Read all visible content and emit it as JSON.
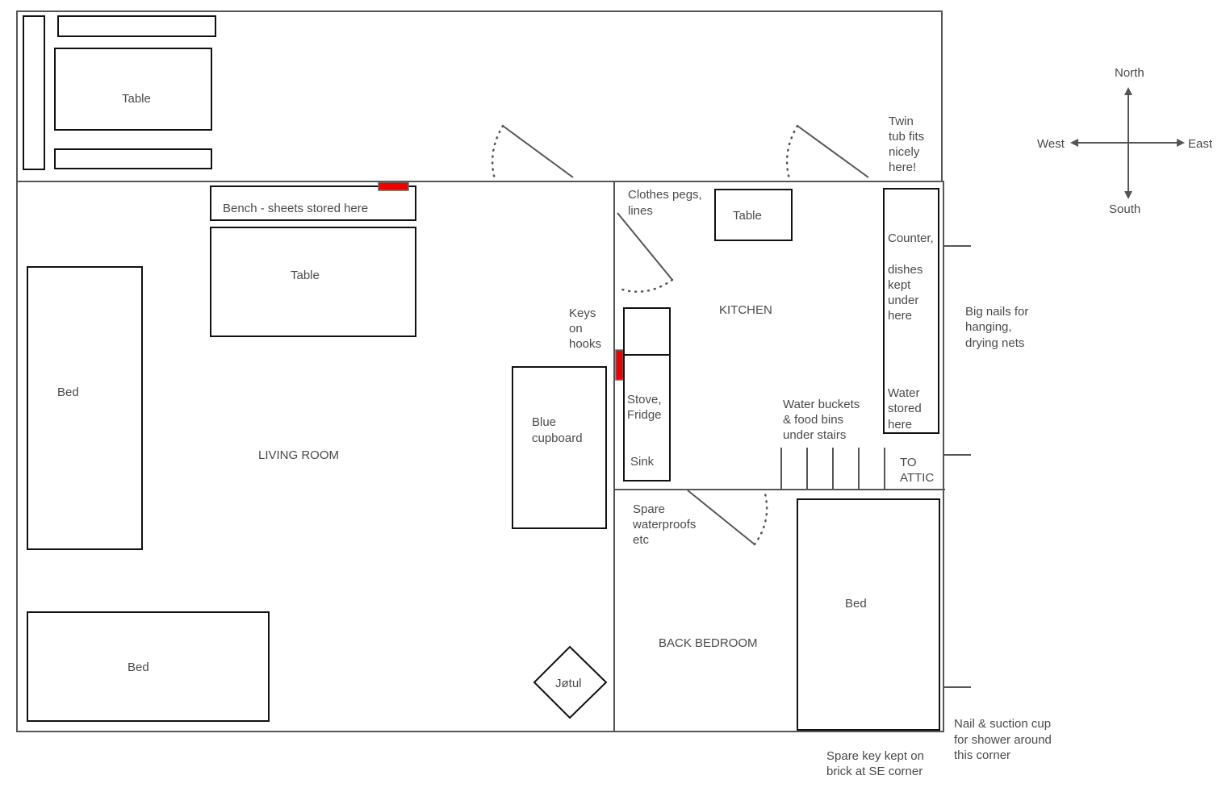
{
  "colors": {
    "wall": "#555555",
    "furniture": "#111111",
    "hook_marker": "#ee0000",
    "text": "#4a4a4a"
  },
  "porch": {
    "table": "Table"
  },
  "living_room": {
    "label": "LIVING ROOM",
    "bench": "Bench - sheets stored here",
    "table": "Table",
    "bed_west": "Bed",
    "bed_south": "Bed",
    "cupboard": [
      "Blue",
      "cupboard"
    ],
    "stove": "Jøtul",
    "keys": [
      "Keys",
      "on",
      "hooks"
    ]
  },
  "kitchen": {
    "label": "KITCHEN",
    "table": "Table",
    "clothes": [
      "Clothes pegs,",
      "lines"
    ],
    "stove_fridge": [
      "Stove,",
      "Fridge"
    ],
    "sink": "Sink",
    "counter": [
      "Counter,",
      "",
      "dishes",
      "kept",
      "under",
      "here"
    ],
    "water": [
      "Water",
      "stored",
      "here"
    ],
    "buckets": [
      "Water buckets",
      "& food bins",
      "under stairs"
    ],
    "attic": [
      "TO",
      "ATTIC"
    ]
  },
  "back_bedroom": {
    "label": "BACK BEDROOM",
    "bed": "Bed",
    "waterproofs": [
      "Spare",
      "waterproofs",
      "etc"
    ]
  },
  "notes": {
    "twin_tub": [
      "Twin",
      "tub fits",
      "nicely",
      "here!"
    ],
    "nails": [
      "Big nails for",
      "hanging,",
      "drying nets"
    ],
    "shower": [
      "Nail & suction cup",
      "for shower around",
      "this corner"
    ],
    "spare_key": [
      "Spare key kept on",
      "brick at SE corner"
    ]
  },
  "compass": {
    "north": "North",
    "south": "South",
    "east": "East",
    "west": "West"
  }
}
